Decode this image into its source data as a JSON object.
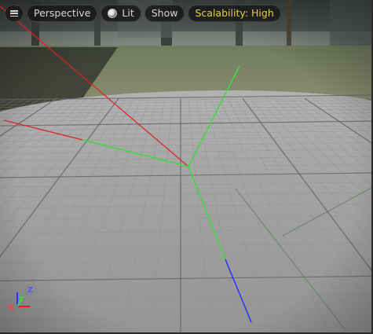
{
  "toolbar": {
    "menu_icon": "hamburger-menu-icon",
    "view_mode_label": "Perspective",
    "lit_icon": "lit-sphere-icon",
    "lighting_label": "Lit",
    "show_label": "Show",
    "scalability_label": "Scalability: High"
  },
  "axis_gizmo": {
    "x_label": "X",
    "y_label": "Y",
    "z_label": "Z"
  },
  "colors": {
    "x_axis": "#e02020",
    "y_axis": "#3ed93e",
    "z_axis": "#2434ff",
    "scalability_text": "#e8cf45"
  }
}
